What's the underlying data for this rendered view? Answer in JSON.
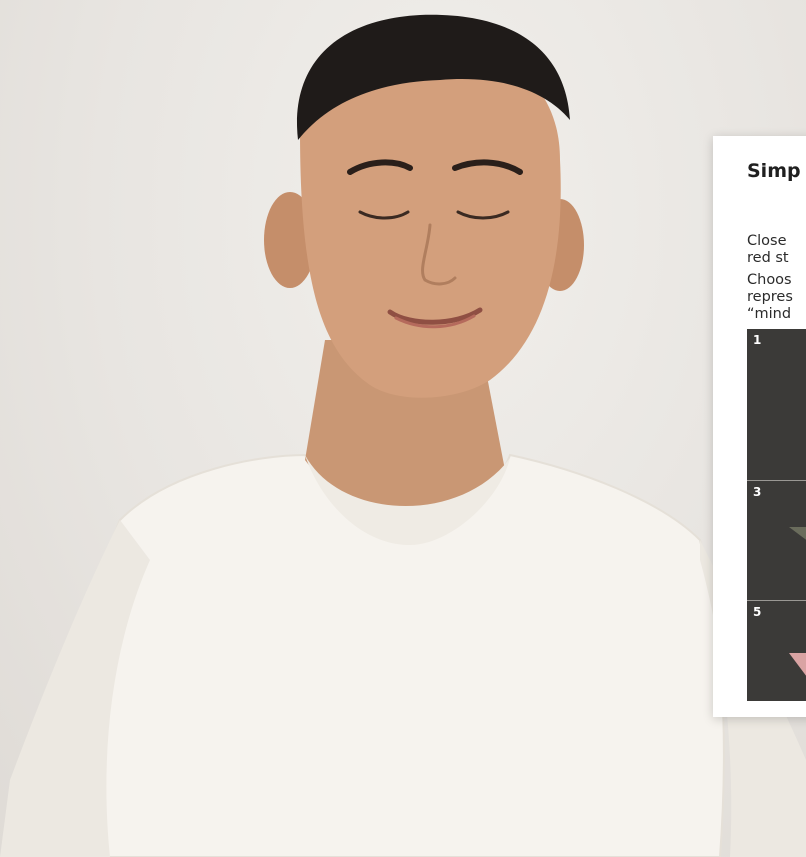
{
  "card": {
    "title": "Simp",
    "paragraph1": [
      "Close",
      "red st"
    ],
    "paragraph2": [
      "Choos",
      "repres",
      "“mind"
    ]
  },
  "grid": {
    "cells": [
      {
        "number": "1"
      },
      {
        "number": "3"
      },
      {
        "number": "5"
      }
    ]
  },
  "colors": {
    "card_bg": "#ffffff",
    "grid_bg": "#3b3a38",
    "cell_label": "#ffffff",
    "shape_green": "#6a6c5c",
    "shape_pink": "#d9a3a3"
  }
}
